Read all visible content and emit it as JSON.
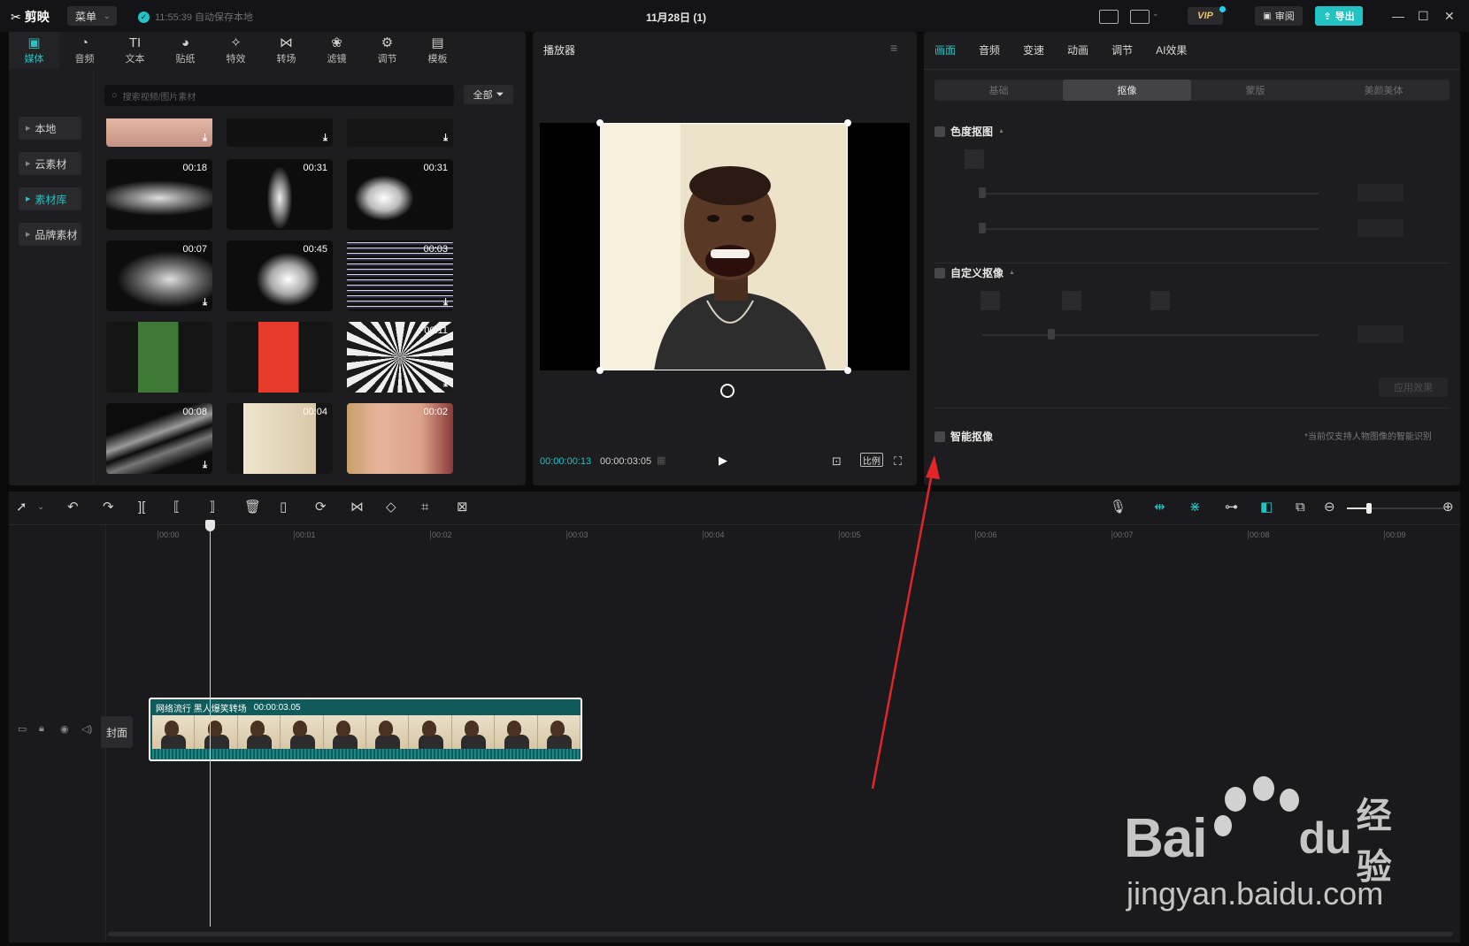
{
  "titlebar": {
    "app_name": "剪映",
    "menu_label": "菜单",
    "autosave": "11:55:39 自动保存本地",
    "project_title": "11月28日 (1)",
    "vip_label": "VIP",
    "review_label": "审阅",
    "export_label": "导出"
  },
  "media": {
    "tabs": [
      {
        "label": "媒体",
        "icon": "media-icon"
      },
      {
        "label": "音频",
        "icon": "audio-icon"
      },
      {
        "label": "文本",
        "icon": "text-icon"
      },
      {
        "label": "贴纸",
        "icon": "sticker-icon"
      },
      {
        "label": "特效",
        "icon": "effects-icon"
      },
      {
        "label": "转场",
        "icon": "transition-icon"
      },
      {
        "label": "滤镜",
        "icon": "filter-icon"
      },
      {
        "label": "调节",
        "icon": "adjust-icon"
      },
      {
        "label": "模板",
        "icon": "template-icon"
      }
    ],
    "side_nav": [
      "本地",
      "云素材",
      "素材库",
      "品牌素材"
    ],
    "search_placeholder": "搜索视频/图片素材",
    "filter_label": "全部",
    "thumbs": [
      {
        "dur": "",
        "kind": "skin"
      },
      {
        "dur": "",
        "kind": "dots"
      },
      {
        "dur": "",
        "kind": "dark"
      },
      {
        "dur": "00:18",
        "kind": "smoke-h"
      },
      {
        "dur": "00:31",
        "kind": "smoke-v"
      },
      {
        "dur": "00:31",
        "kind": "smoke-c"
      },
      {
        "dur": "00:07",
        "kind": "smoke-b"
      },
      {
        "dur": "00:45",
        "kind": "smoke-r"
      },
      {
        "dur": "00:03",
        "kind": "glitch"
      },
      {
        "dur": "",
        "kind": "green"
      },
      {
        "dur": "",
        "kind": "red"
      },
      {
        "dur": "00:11",
        "kind": "rays"
      },
      {
        "dur": "00:08",
        "kind": "lightning"
      },
      {
        "dur": "00:04",
        "kind": "man"
      },
      {
        "dur": "00:02",
        "kind": "baby"
      }
    ]
  },
  "player": {
    "title": "播放器",
    "current_time": "00:00:00:13",
    "total_time": "00:00:03:05",
    "ratio_label": "比例"
  },
  "props": {
    "tabs": [
      "画面",
      "音频",
      "变速",
      "动画",
      "调节",
      "AI效果"
    ],
    "subtabs": [
      "基础",
      "抠像",
      "蒙版",
      "美颜美体"
    ],
    "chroma_title": "色度抠图",
    "custom_title": "自定义抠像",
    "smart_title": "智能抠像",
    "apply_label": "应用效果",
    "smart_note": "*当前仅支持人物图像的智能识别"
  },
  "timeline": {
    "ticks": [
      "00:00",
      "00:01",
      "00:02",
      "00:03",
      "00:04",
      "00:05",
      "00:06",
      "00:07",
      "00:08",
      "00:09"
    ],
    "cover_label": "封面",
    "clip_name": "网络流行 黑人爆笑转场",
    "clip_duration": "00:00:03.05"
  },
  "watermark": {
    "brand": "Bai",
    "brand_du": "du",
    "brand_cn": "经验",
    "url": "jingyan.baidu.com"
  }
}
